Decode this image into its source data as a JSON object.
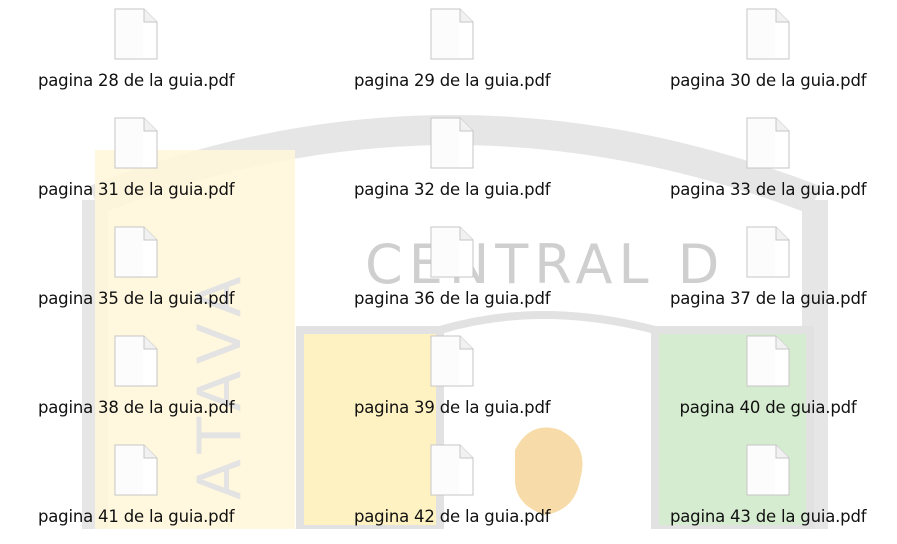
{
  "files": [
    "pagina 28 de la guia.pdf",
    "pagina 29 de la guia.pdf",
    "pagina 30 de la guia.pdf",
    "pagina 31 de la guia.pdf",
    "pagina 32 de la guia.pdf",
    "pagina 33 de la guia.pdf",
    "pagina 35 de la guia.pdf",
    "pagina 36 de la guia.pdf",
    "pagina 37 de la guia.pdf",
    "pagina 38 de la guia.pdf",
    "pagina 39 de la guia.pdf",
    "pagina 40 de guia.pdf",
    "pagina 41 de la guia.pdf",
    "pagina 42 de la guia.pdf",
    "pagina 43 de la guia.pdf"
  ],
  "icons": {
    "file": "pdf-file-icon"
  },
  "watermark": {
    "text_top": "CENTRAL D",
    "text_left": "ATAVA",
    "colors": {
      "gray": "#d9d9d9",
      "yellow": "#fff3c4",
      "green": "#d6ecd2",
      "orange": "#f6dcab"
    }
  }
}
